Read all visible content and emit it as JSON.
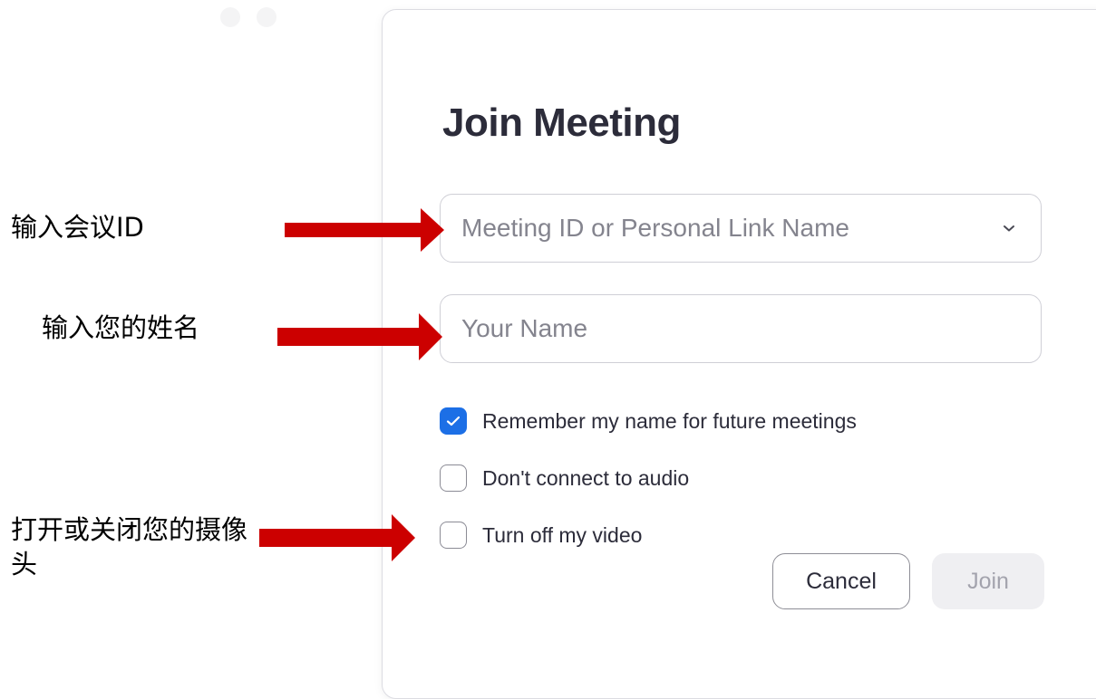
{
  "dialog": {
    "title": "Join Meeting",
    "meeting_field": {
      "placeholder": "Meeting ID or Personal Link Name",
      "value": ""
    },
    "name_field": {
      "placeholder": "Your Name",
      "value": ""
    },
    "options": [
      {
        "label": "Remember my name for future meetings",
        "checked": true
      },
      {
        "label": "Don't connect to audio",
        "checked": false
      },
      {
        "label": "Turn off my video",
        "checked": false
      }
    ],
    "cancel_label": "Cancel",
    "join_label": "Join"
  },
  "annotations": {
    "meeting_id": "输入会议ID",
    "name": "输入您的姓名",
    "video": "打开或关闭您的摄像头"
  },
  "colors": {
    "accent": "#1c6fe6",
    "arrow": "#cc0000",
    "title": "#2c2c3a",
    "placeholder": "#84848e"
  },
  "icons": {
    "dropdown": "chevron-down-icon",
    "check": "checkmark-icon",
    "window_controls": "window-control-dot-icon"
  }
}
